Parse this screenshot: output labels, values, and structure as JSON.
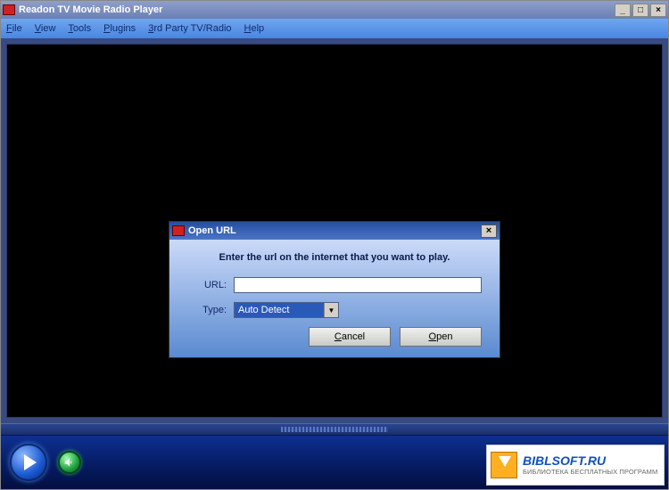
{
  "titlebar": {
    "title": "Readon TV Movie Radio Player"
  },
  "menubar": {
    "file": "File",
    "file_u": "F",
    "view": "View",
    "view_u": "V",
    "tools": "Tools",
    "tools_u": "T",
    "plugins": "Plugins",
    "plugins_u": "P",
    "thirdparty": "3rd Party TV/Radio",
    "thirdparty_u": "3",
    "help": "Help",
    "help_u": "H"
  },
  "dialog": {
    "title": "Open URL",
    "prompt": "Enter the url on the internet that you want to play.",
    "url_label": "URL:",
    "url_value": "",
    "type_label": "Type:",
    "type_value": "Auto Detect",
    "cancel": "Cancel",
    "cancel_u": "C",
    "open": "Open",
    "open_u": "O"
  },
  "watermark": {
    "brand": "BIBLSOFT.RU",
    "tagline": "БИБЛИОТЕКА БЕСПЛАТНЫХ ПРОГРАММ"
  }
}
